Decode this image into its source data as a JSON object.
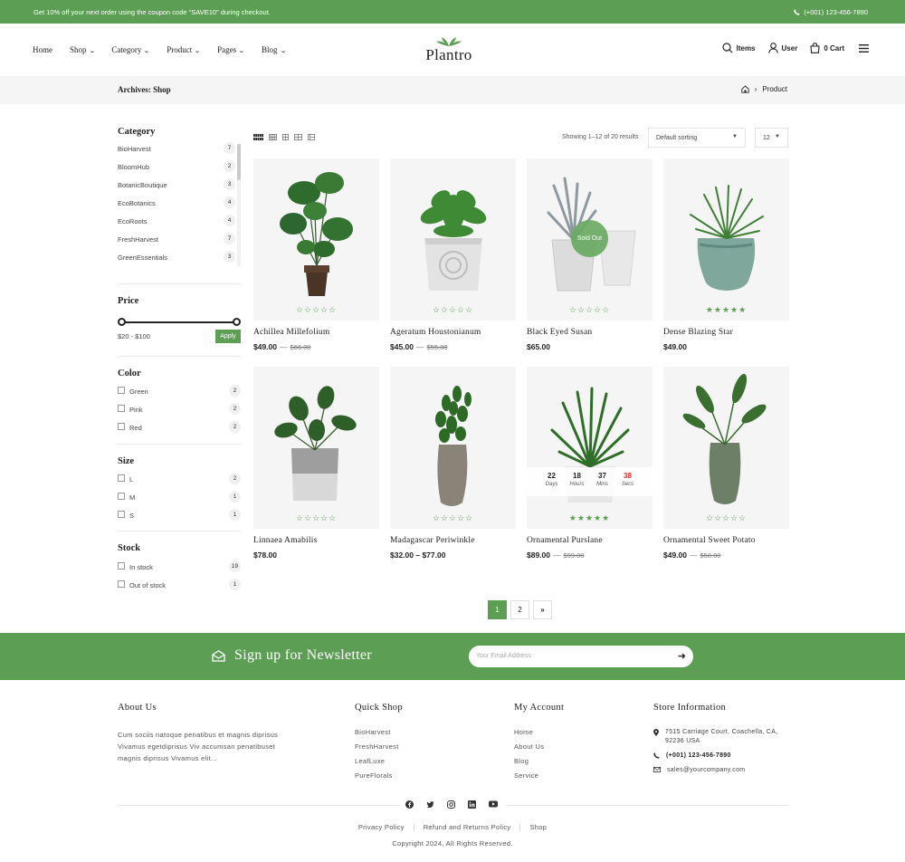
{
  "topbar": {
    "promo": "Get 10% off your next order using the coupon code \"SAVE10\" during checkout.",
    "phone": "(+001) 123-456-7890"
  },
  "nav": {
    "items": [
      {
        "label": "Home"
      },
      {
        "label": "Shop"
      },
      {
        "label": "Category"
      },
      {
        "label": "Product"
      },
      {
        "label": "Pages"
      },
      {
        "label": "Blog"
      }
    ]
  },
  "logo": {
    "text": "Plantro"
  },
  "header_actions": {
    "search": "Items",
    "user": "User",
    "cart": "0 Cart"
  },
  "breadcrumb": {
    "title": "Archives: Shop",
    "current": "Product"
  },
  "sidebar": {
    "category_title": "Category",
    "categories": [
      {
        "name": "BioHarvest",
        "count": "7"
      },
      {
        "name": "BloomHub",
        "count": "2"
      },
      {
        "name": "BotanicBoutique",
        "count": "3"
      },
      {
        "name": "EcoBotanics",
        "count": "4"
      },
      {
        "name": "EcoRoots",
        "count": "4"
      },
      {
        "name": "FreshHarvest",
        "count": "7"
      },
      {
        "name": "GreenEssentials",
        "count": "3"
      }
    ],
    "price_title": "Price",
    "price_range": "$20 - $100",
    "apply_label": "Apply",
    "color_title": "Color",
    "colors": [
      {
        "name": "Green",
        "count": "2"
      },
      {
        "name": "Pink",
        "count": "2"
      },
      {
        "name": "Red",
        "count": "2"
      }
    ],
    "size_title": "Size",
    "sizes": [
      {
        "name": "L",
        "count": "2"
      },
      {
        "name": "M",
        "count": "1"
      },
      {
        "name": "S",
        "count": "1"
      }
    ],
    "stock_title": "Stock",
    "stock": [
      {
        "name": "In stock",
        "count": "19"
      },
      {
        "name": "Out of stock",
        "count": "1"
      }
    ]
  },
  "toolbar": {
    "showing": "Showing 1–12 of 20 results",
    "sort": "Default sorting",
    "per_page": "12"
  },
  "products": [
    {
      "name": "Achillea Millefolium",
      "price": "$49.00",
      "old_price": "$66.00",
      "rating": 0
    },
    {
      "name": "Ageratum Houstonianum",
      "price": "$45.00",
      "old_price": "$55.00",
      "rating": 0
    },
    {
      "name": "Black Eyed Susan",
      "price": "$65.00",
      "badge": "Sold Out",
      "rating": 0
    },
    {
      "name": "Dense Blazing Star",
      "price": "$49.00",
      "rating": 5
    },
    {
      "name": "Linnaea Amabilis",
      "price": "$78.00",
      "rating": 0
    },
    {
      "name": "Madagascar Periwinkle",
      "price": "$32.00 – $77.00",
      "rating": 0
    },
    {
      "name": "Ornamental Purslane",
      "price": "$89.00",
      "old_price": "$99.00",
      "rating": 5,
      "countdown": {
        "days": "22",
        "hours": "18",
        "mins": "37",
        "secs": "38",
        "days_label": "Days",
        "hours_label": "Hours",
        "mins_label": "Mins",
        "secs_label": "Secs"
      }
    },
    {
      "name": "Ornamental Sweet Potato",
      "price": "$49.00",
      "old_price": "$58.00",
      "rating": 0
    }
  ],
  "pagination": {
    "pages": [
      "1",
      "2"
    ],
    "next": "»",
    "current": "1"
  },
  "newsletter": {
    "title": "Sign up for Newsletter",
    "placeholder": "Your Email Address"
  },
  "footer": {
    "about_title": "About Us",
    "about_text": "Cum sociis natoque penatibus et magnis diprisus Vivamus egetdiprisus Viv accumsan penatibuset magnis diprisus Vivamus elit...",
    "quick_title": "Quick Shop",
    "quick_links": [
      "BioHarvest",
      "FreshHarvest",
      "LeafLuxe",
      "PureFlorals"
    ],
    "account_title": "My Account",
    "account_links": [
      "Home",
      "About Us",
      "Blog",
      "Service"
    ],
    "store_title": "Store Information",
    "address": "7515 Carriage Court, Coachella, CA, 92236 USA",
    "phone": "(+001) 123-456-7890",
    "email": "sales@yourcompany.com",
    "bottom_links": [
      "Privacy Policy",
      "Refund and Returns Policy",
      "Shop"
    ],
    "copyright": "Copyright 2024, All Rights Reserved."
  },
  "colors": {
    "brand": "#5c9e54",
    "sale_red": "#d9302c"
  }
}
